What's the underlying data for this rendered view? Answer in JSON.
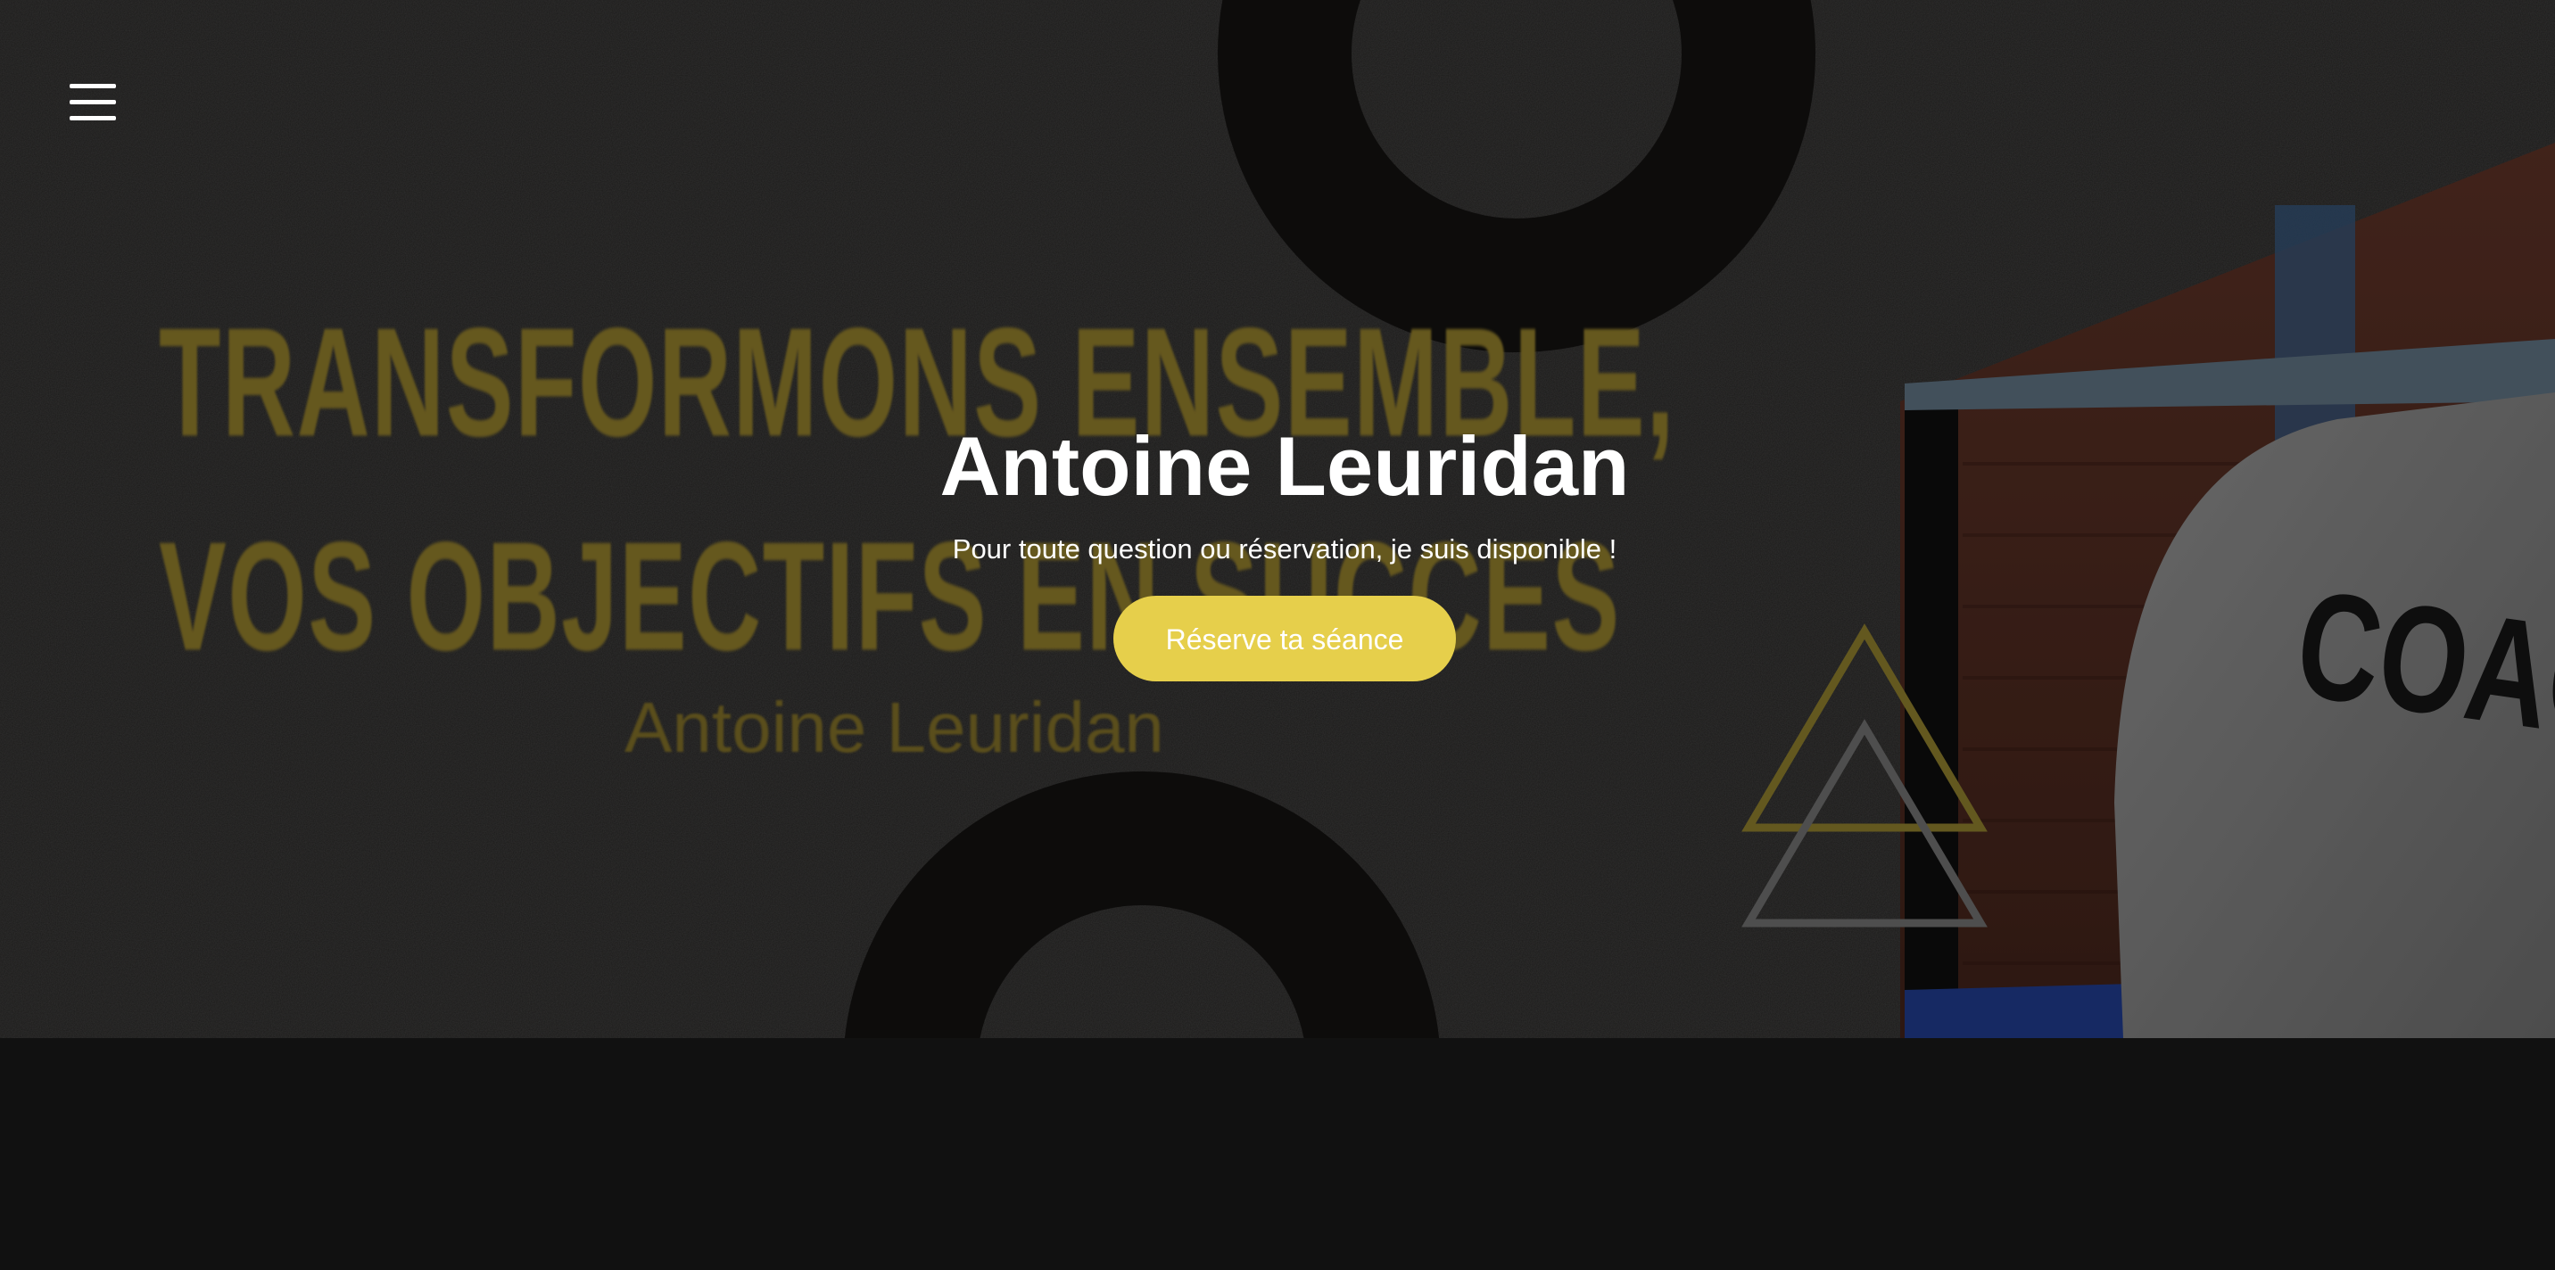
{
  "header": {
    "menu_icon": "hamburger-menu-icon"
  },
  "hero": {
    "background": {
      "poster_line_1": "TRANSFORMONS ENSEMBLE,",
      "poster_line_2": "VOS OBJECTIFS EN SUCCES",
      "poster_name": "Antoine Leuridan",
      "shirt_text": "COAC"
    },
    "title": "Antoine Leuridan",
    "subtitle": "Pour toute question ou réservation, je suis disponible !",
    "cta_label": "Réserve ta séance"
  },
  "colors": {
    "accent": "#e6cf4b",
    "poster_text": "#8d7a2a",
    "page_background": "#111111"
  }
}
